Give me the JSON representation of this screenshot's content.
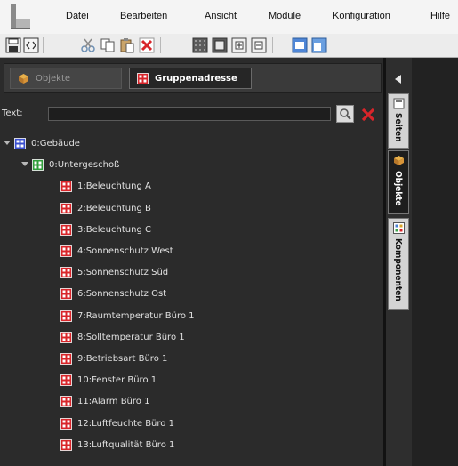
{
  "menu": [
    "Datei",
    "Bearbeiten",
    "Ansicht",
    "Module",
    "Konfiguration",
    "Hilfe"
  ],
  "panel": {
    "tabs": [
      {
        "label": "Objekte",
        "icon": "cube-icon"
      },
      {
        "label": "Gruppenadresse",
        "icon": "group-address-icon"
      }
    ],
    "search_label": "Text:",
    "search_value": ""
  },
  "tree": [
    {
      "label": "0:Gebäude",
      "level": 0,
      "expanded": true,
      "icon": "building-group-icon"
    },
    {
      "label": "0:Untergeschoß",
      "level": 1,
      "expanded": true,
      "icon": "middle-group-icon"
    },
    {
      "label": "1:Beleuchtung A",
      "level": 2,
      "icon": "group-address-icon"
    },
    {
      "label": "2:Beleuchtung B",
      "level": 2,
      "icon": "group-address-icon"
    },
    {
      "label": "3:Beleuchtung C",
      "level": 2,
      "icon": "group-address-icon"
    },
    {
      "label": "4:Sonnenschutz West",
      "level": 2,
      "icon": "group-address-icon"
    },
    {
      "label": "5:Sonnenschutz Süd",
      "level": 2,
      "icon": "group-address-icon"
    },
    {
      "label": "6:Sonnenschutz Ost",
      "level": 2,
      "icon": "group-address-icon"
    },
    {
      "label": "7:Raumtemperatur Büro 1",
      "level": 2,
      "icon": "group-address-icon"
    },
    {
      "label": "8:Solltemperatur Büro 1",
      "level": 2,
      "icon": "group-address-icon"
    },
    {
      "label": "9:Betriebsart Büro 1",
      "level": 2,
      "icon": "group-address-icon"
    },
    {
      "label": "10:Fenster Büro 1",
      "level": 2,
      "icon": "group-address-icon"
    },
    {
      "label": "11:Alarm Büro 1",
      "level": 2,
      "icon": "group-address-icon"
    },
    {
      "label": "12:Luftfeuchte Büro 1",
      "level": 2,
      "icon": "group-address-icon"
    },
    {
      "label": "13:Luftqualität Büro 1",
      "level": 2,
      "icon": "group-address-icon"
    }
  ],
  "side_tabs": [
    {
      "label": "Seiten",
      "icon": "pages-icon",
      "active": false
    },
    {
      "label": "Objekte",
      "icon": "cube-icon",
      "active": true
    },
    {
      "label": "Komponenten",
      "icon": "components-icon",
      "active": false
    }
  ],
  "colors": {
    "accent_red": "#d8252a",
    "active_tab_bg": "#262626",
    "panel_bg": "#2b2b2b"
  }
}
